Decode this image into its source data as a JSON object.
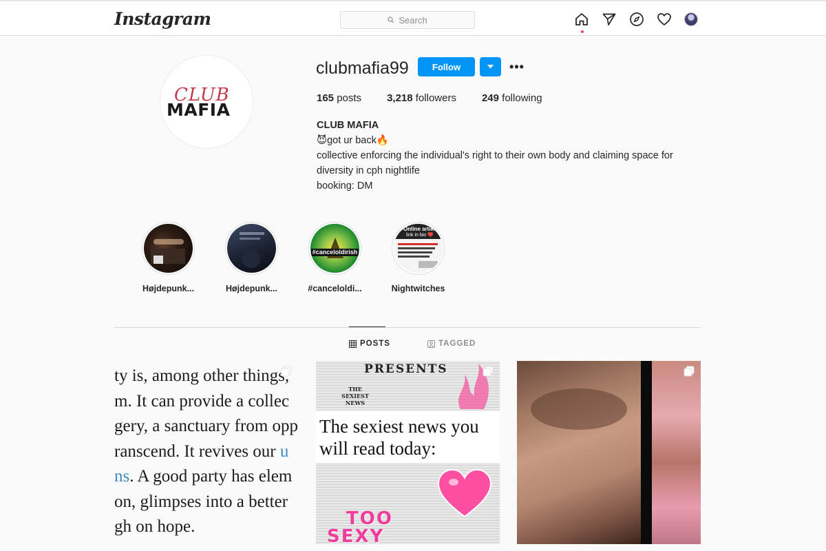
{
  "header": {
    "logo": "Instagram",
    "search_placeholder": "Search",
    "icons": [
      "home-icon",
      "direct-icon",
      "explore-icon",
      "activity-heart-icon",
      "profile-avatar"
    ]
  },
  "profile": {
    "username": "clubmafia99",
    "follow_label": "Follow",
    "more_label": "•••",
    "avatar_text_top": "CLUB",
    "avatar_text_bottom": "MAFIA",
    "stats": {
      "posts_count": "165",
      "posts_label": "posts",
      "followers_count": "3,218",
      "followers_label": "followers",
      "following_count": "249",
      "following_label": "following"
    },
    "bio": {
      "name": "CLUB MAFIA",
      "line1": "😈got ur back🔥",
      "line2": "collective enforcing the individual's right to their own body and claiming space for",
      "line3": "diversity in cph nightlife",
      "line4": "booking: DM"
    }
  },
  "highlights": [
    {
      "label": "Højdepunk..."
    },
    {
      "label": "Højdepunk..."
    },
    {
      "label": "#canceloldi..."
    },
    {
      "label": "Nightwitches"
    }
  ],
  "highlight_texts": {
    "h3_overlay": "#canceloldirish",
    "h4_top": "Online artikel",
    "h4_sub": "link in bio ❤️"
  },
  "tabs": [
    {
      "label": "POSTS",
      "active": true
    },
    {
      "label": "TAGGED",
      "active": false
    }
  ],
  "posts": {
    "post1_lines": [
      "ty is, among other things,",
      "m. It can provide a collec",
      "gery, a sanctuary from opp",
      "ranscend. It revives our ",
      "ns",
      ". A good party has elem",
      "on, glimpses into a better",
      "gh on hope."
    ],
    "post1_blue_fragment": "u",
    "post2_presents": "PRESENTS",
    "post2_news_title": "THE SEXIEST NEWS",
    "post2_headline_1": "The sexiest news you",
    "post2_headline_2": "will read today:",
    "post2_too": "TOO",
    "post2_sexy": "SEXY"
  }
}
